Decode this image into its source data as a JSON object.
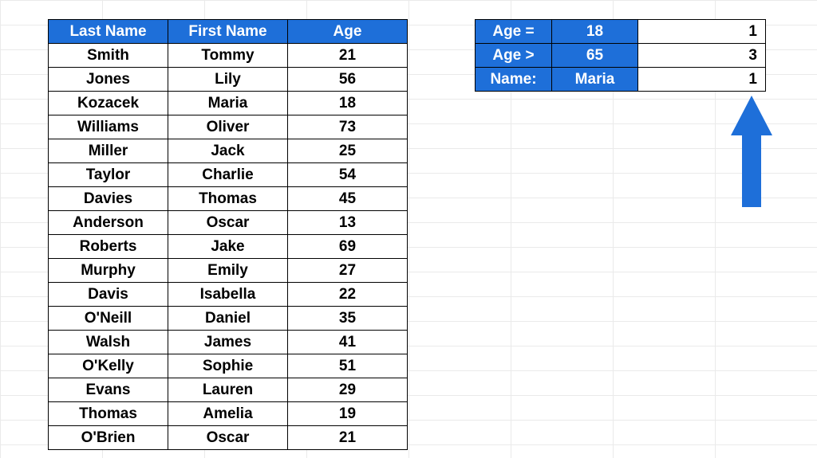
{
  "main_table": {
    "headers": [
      "Last Name",
      "First Name",
      "Age"
    ],
    "rows": [
      [
        "Smith",
        "Tommy",
        "21"
      ],
      [
        "Jones",
        "Lily",
        "56"
      ],
      [
        "Kozacek",
        "Maria",
        "18"
      ],
      [
        "Williams",
        "Oliver",
        "73"
      ],
      [
        "Miller",
        "Jack",
        "25"
      ],
      [
        "Taylor",
        "Charlie",
        "54"
      ],
      [
        "Davies",
        "Thomas",
        "45"
      ],
      [
        "Anderson",
        "Oscar",
        "13"
      ],
      [
        "Roberts",
        "Jake",
        "69"
      ],
      [
        "Murphy",
        "Emily",
        "27"
      ],
      [
        "Davis",
        "Isabella",
        "22"
      ],
      [
        "O'Neill",
        "Daniel",
        "35"
      ],
      [
        "Walsh",
        "James",
        "41"
      ],
      [
        "O'Kelly",
        "Sophie",
        "51"
      ],
      [
        "Evans",
        "Lauren",
        "29"
      ],
      [
        "Thomas",
        "Amelia",
        "19"
      ],
      [
        "O'Brien",
        "Oscar",
        "21"
      ]
    ]
  },
  "summary": {
    "rows": [
      {
        "label": "Age =",
        "value": "18",
        "result": "1"
      },
      {
        "label": "Age >",
        "value": "65",
        "result": "3"
      },
      {
        "label": "Name:",
        "value": "Maria",
        "result": "1"
      }
    ]
  },
  "colors": {
    "accent": "#1e6fd9"
  }
}
